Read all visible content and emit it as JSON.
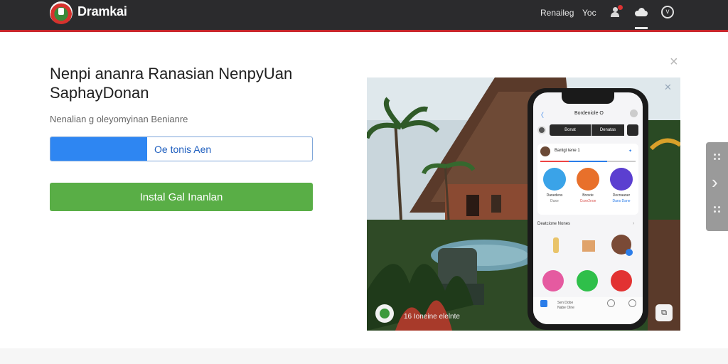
{
  "header": {
    "brand": "Dramkai",
    "nav": [
      "Renaileg",
      "Yoc"
    ],
    "icons": [
      "user-icon",
      "cloud-icon",
      "chevron-circle-icon"
    ]
  },
  "main": {
    "headline": "Nenpi ananra Ranasian NenpyUan SaphayDonan",
    "subline": "Nenalian g oleyomyinan Benianre",
    "progress": {
      "label": "Oe tonis Aen",
      "fraction": 0.37
    },
    "install_label": "Instal Gal Inanlan",
    "close_symbol": "×"
  },
  "phone": {
    "back": "〈",
    "title": "Bordeniole O",
    "tabs": [
      "Bonat",
      "Denatas"
    ],
    "card_name": "Bantgt tene 1",
    "apps": [
      {
        "line1": "Danedens",
        "line2": "Daxe",
        "color": "#3aa3e8"
      },
      {
        "line1": "Bnoxte",
        "line2": "Coxe2noe",
        "color": "#e8702b"
      },
      {
        "line1": "Decnaaner",
        "line2": "Dans Dane",
        "color": "#5b3fd0"
      }
    ],
    "section_title": "Deatcione Nones",
    "bottom_text": [
      "Sen Dobe",
      "Nabe Olne"
    ]
  },
  "scene": {
    "caption": "16  Ioneine elelnte",
    "button_icon": "crop-icon"
  },
  "colors": {
    "topbar": "#2b2b2d",
    "accent_red": "#c8262b",
    "progress_blue": "#2e86f2",
    "install_green": "#59ae46"
  }
}
